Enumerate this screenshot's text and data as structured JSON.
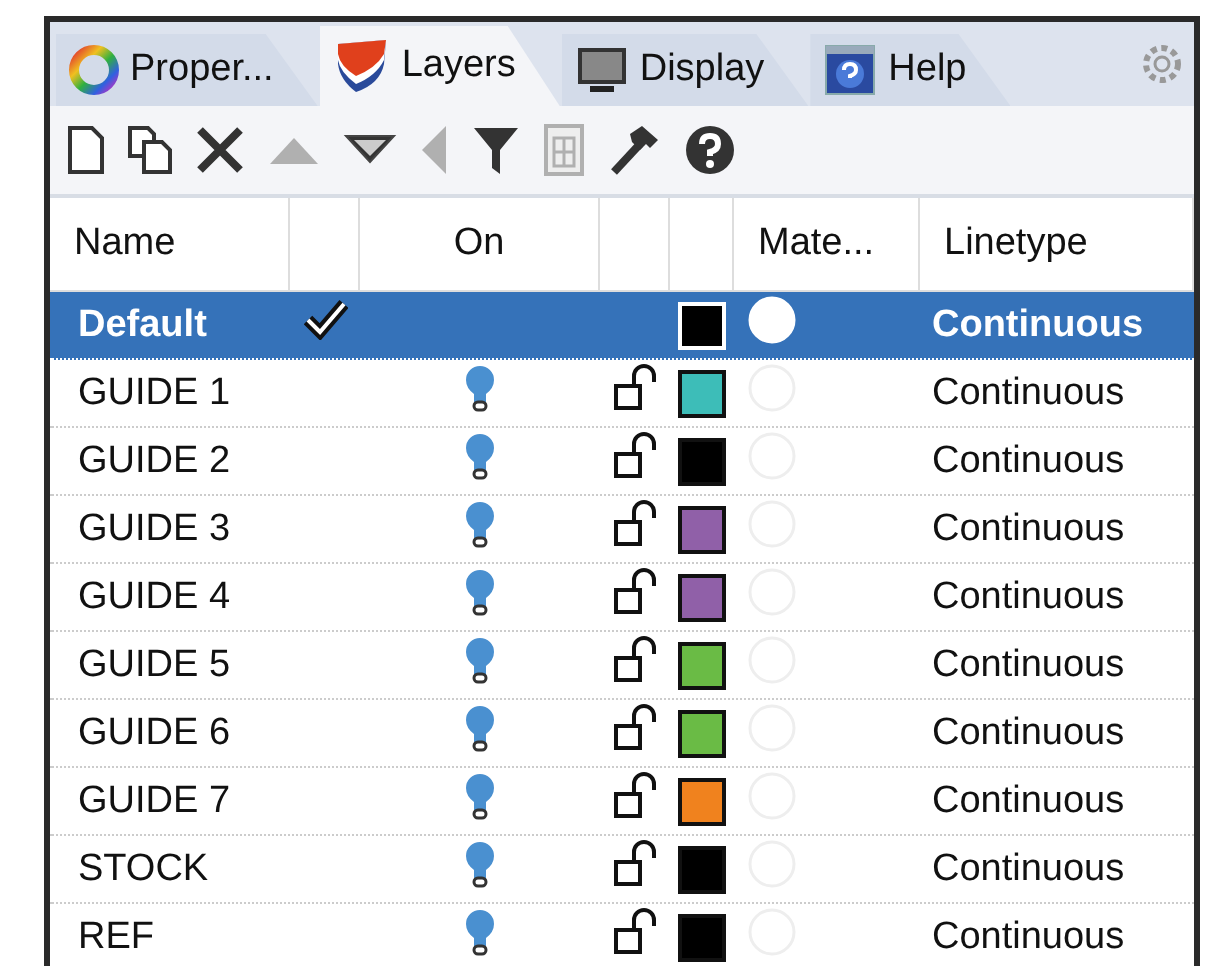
{
  "tabs": [
    {
      "label": "Proper...",
      "kind": "properties",
      "selected": false
    },
    {
      "label": "Layers",
      "kind": "layers",
      "selected": true
    },
    {
      "label": "Display",
      "kind": "display",
      "selected": false
    },
    {
      "label": "Help",
      "kind": "help",
      "selected": false
    }
  ],
  "toolbar": [
    {
      "kind": "new",
      "disabled": false
    },
    {
      "kind": "copy",
      "disabled": false
    },
    {
      "kind": "delete",
      "disabled": false
    },
    {
      "kind": "up",
      "disabled": true
    },
    {
      "kind": "down",
      "disabled": false
    },
    {
      "kind": "left",
      "disabled": true
    },
    {
      "kind": "filter",
      "disabled": false
    },
    {
      "kind": "grid",
      "disabled": true
    },
    {
      "kind": "hammer",
      "disabled": false
    },
    {
      "kind": "help",
      "disabled": false
    }
  ],
  "table": {
    "columns": [
      "Name",
      "On",
      "Mate...",
      "Linetype"
    ],
    "rows": [
      {
        "name": "Default",
        "current": true,
        "selected": true,
        "color": "#000000",
        "linetype": "Continuous"
      },
      {
        "name": "GUIDE 1",
        "current": false,
        "selected": false,
        "color": "#3dbdb8",
        "linetype": "Continuous"
      },
      {
        "name": "GUIDE 2",
        "current": false,
        "selected": false,
        "color": "#000000",
        "linetype": "Continuous"
      },
      {
        "name": "GUIDE 3",
        "current": false,
        "selected": false,
        "color": "#9060a8",
        "linetype": "Continuous"
      },
      {
        "name": "GUIDE 4",
        "current": false,
        "selected": false,
        "color": "#9060a8",
        "linetype": "Continuous"
      },
      {
        "name": "GUIDE 5",
        "current": false,
        "selected": false,
        "color": "#6abb45",
        "linetype": "Continuous"
      },
      {
        "name": "GUIDE 6",
        "current": false,
        "selected": false,
        "color": "#6abb45",
        "linetype": "Continuous"
      },
      {
        "name": "GUIDE 7",
        "current": false,
        "selected": false,
        "color": "#f0821e",
        "linetype": "Continuous"
      },
      {
        "name": "STOCK",
        "current": false,
        "selected": false,
        "color": "#000000",
        "linetype": "Continuous"
      },
      {
        "name": "REF",
        "current": false,
        "selected": false,
        "color": "#000000",
        "linetype": "Continuous"
      }
    ]
  }
}
